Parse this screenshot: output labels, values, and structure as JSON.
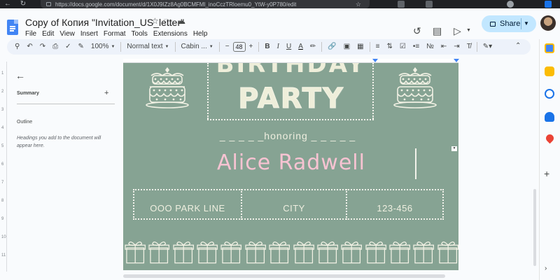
{
  "browser": {
    "url": "https://docs.google.com/document/d/1X0J9IZz8Ag0BCMFMl_inoCczTRloemu0_YtW-y0P780/edit"
  },
  "document": {
    "title": "Copy of Копия \"Invitation_US_letter\""
  },
  "menubar": {
    "items": [
      "File",
      "Edit",
      "View",
      "Insert",
      "Format",
      "Tools",
      "Extensions",
      "Help"
    ]
  },
  "share": {
    "label": "Share"
  },
  "toolbar": {
    "zoom": "100%",
    "style": "Normal text",
    "font": "Cabin ...",
    "font_size": "48",
    "bold": "B",
    "italic": "I",
    "underline": "U",
    "text_color": "A"
  },
  "side_panel": {
    "summary_label": "Summary",
    "outline_label": "Outline",
    "outline_hint": "Headings you add to the document will appear here."
  },
  "ruler": {
    "ticks": [
      "1",
      "2",
      "3",
      "4",
      "5",
      "6",
      "7",
      "8",
      "9",
      "10",
      "11"
    ]
  },
  "invitation": {
    "title_top": "BIRTHDAY",
    "title": "PARTY",
    "honoring": "_ _ _ _ _honoring _ _ _ _ _",
    "guest_name": "Alice Radwell",
    "address": "OOO PARK LINE",
    "city": "CITY",
    "number": "123-456"
  },
  "colors": {
    "page_bg": "#86a393",
    "name_pink": "#f7c3d2",
    "share_bg": "#c2e7ff",
    "toolbar_bg": "#edf2fa"
  },
  "icons": {
    "back": "arrow-left-icon",
    "refresh": "refresh-icon",
    "star": "star-icon",
    "folder": "move-folder-icon",
    "cloud": "cloud-saved-icon",
    "history": "history-icon",
    "comment": "comment-icon",
    "meet": "video-camera-icon",
    "search": "search-icon",
    "undo": "undo-icon",
    "redo": "redo-icon",
    "print": "print-icon",
    "spellcheck": "spellcheck-icon",
    "paint": "paint-format-icon",
    "link": "link-icon",
    "comment_add": "add-comment-icon",
    "image": "insert-image-icon",
    "align": "align-icon",
    "line_spacing": "line-spacing-icon",
    "checklist": "checklist-icon",
    "bullets": "bullet-list-icon",
    "numbered": "numbered-list-icon",
    "indent_less": "decrease-indent-icon",
    "indent_more": "increase-indent-icon",
    "clear": "clear-format-icon",
    "pen": "editing-mode-icon",
    "collapse": "chevron-up-icon"
  }
}
